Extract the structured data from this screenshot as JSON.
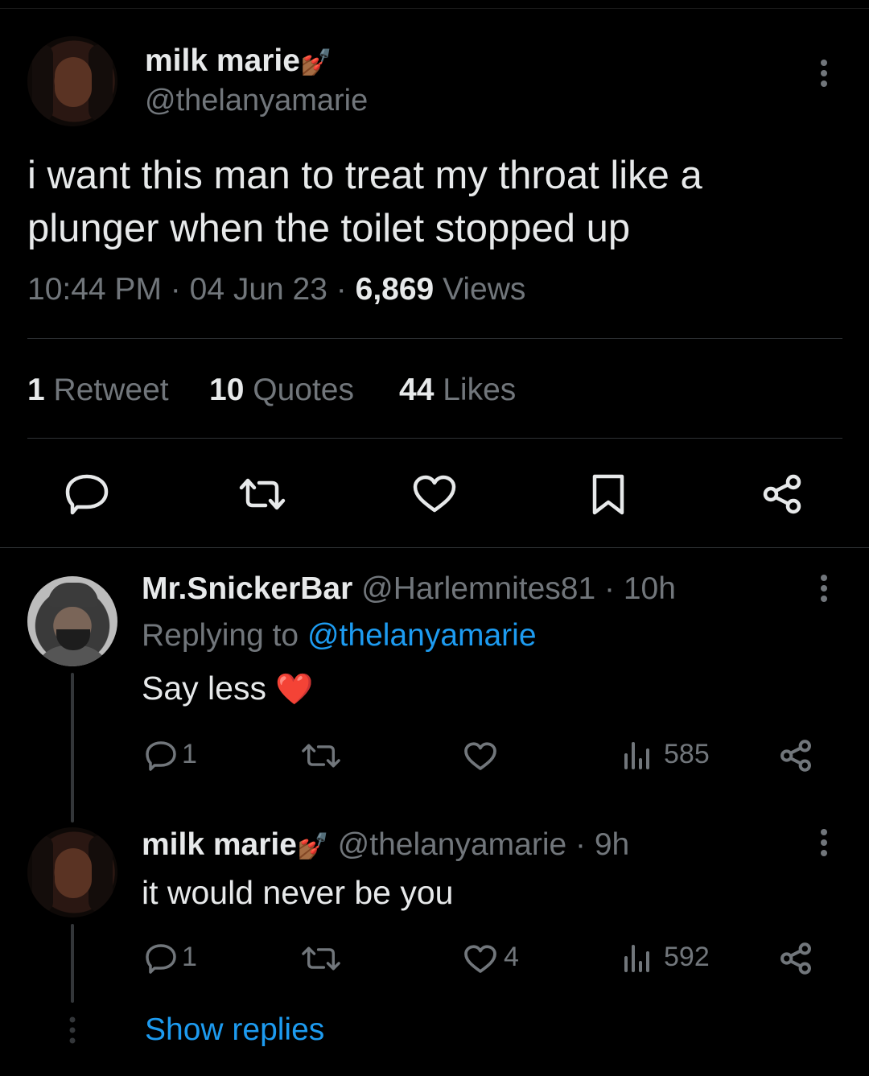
{
  "main_tweet": {
    "display_name": "milk marie",
    "name_emoji": "💅🏾",
    "handle": "@thelanyamarie",
    "text_line1": "i want this man to treat my throat like a",
    "text_line2": "plunger when the toilet stopped up",
    "time": "10:44 PM",
    "date": "04 Jun 23",
    "views_count": "6,869",
    "views_label": "Views",
    "sep": "·",
    "retweets_count": "1",
    "retweets_label": "Retweet",
    "quotes_count": "10",
    "quotes_label": "Quotes",
    "likes_count": "44",
    "likes_label": "Likes"
  },
  "reply1": {
    "display_name": "Mr.SnickerBar",
    "handle_time": "@Harlemnites81 · 10h",
    "replying_prefix": "Replying to",
    "replying_handle": "@thelanyamarie",
    "text": "Say less",
    "text_emoji": "❤️",
    "reply_count": "1",
    "views_count": "585"
  },
  "reply2": {
    "display_name": "milk marie",
    "name_emoji": "💅🏾",
    "handle_time": "@thelanyamarie · 9h",
    "text": "it would never be you",
    "reply_count": "1",
    "like_count": "4",
    "views_count": "592"
  },
  "show_replies_label": "Show replies",
  "icons": {
    "more": "more-vertical-icon",
    "reply": "reply-icon",
    "retweet": "retweet-icon",
    "like": "heart-icon",
    "bookmark": "bookmark-icon",
    "share": "share-icon",
    "views": "views-icon"
  },
  "colors": {
    "background": "#000000",
    "text": "#e7e9ea",
    "secondary": "#71767b",
    "link": "#1d9bf0",
    "divider": "#2f3336"
  }
}
